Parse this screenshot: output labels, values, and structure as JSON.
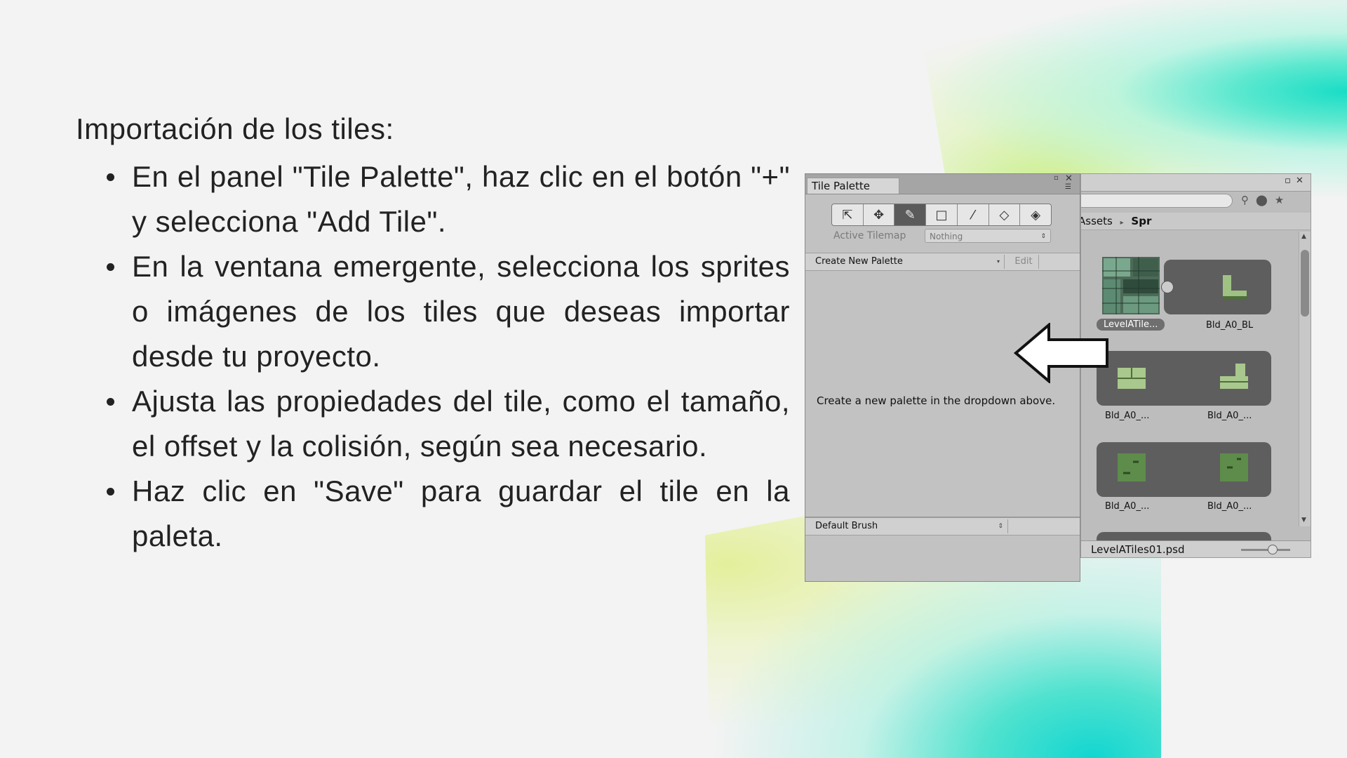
{
  "slide": {
    "title": "Importación de los tiles:",
    "bullets": [
      "En el panel \"Tile Palette\", haz clic en el botón \"+\" y selecciona \"Add Tile\".",
      "En la ventana emergente, selecciona los sprites o imágenes de los tiles que deseas importar desde tu proyecto.",
      "Ajusta las propiedades del tile, como el tamaño, el offset y la colisión, según sea necesario.",
      "Haz clic en \"Save\" para guardar el tile en la paleta."
    ]
  },
  "tile_palette": {
    "tab_title": "Tile Palette",
    "tools": [
      "select-tool",
      "move-tool",
      "paint-brush-tool",
      "box-fill-tool",
      "picker-tool",
      "eraser-tool",
      "flood-fill-tool"
    ],
    "active_tool": "paint-brush-tool",
    "active_tilemap_label": "Active Tilemap",
    "active_tilemap_value": "Nothing",
    "palette_dropdown": "Create New Palette",
    "edit_button": "Edit",
    "empty_message": "Create a new palette in the dropdown above.",
    "brush_dropdown": "Default Brush"
  },
  "project_panel": {
    "breadcrumb_part1": "Assets",
    "breadcrumb_sep": "▸",
    "breadcrumb_part2": "Spr",
    "assets": [
      {
        "label": "LevelATile..."
      },
      {
        "label": "Bld_A0_BL"
      },
      {
        "label": "Bld_A0_..."
      },
      {
        "label": "Bld_A0_..."
      },
      {
        "label": "Bld_A0_..."
      },
      {
        "label": "Bld_A0_..."
      }
    ],
    "footer_file": "LevelATiles01.psd"
  },
  "colors": {
    "background": "#f3f3f3",
    "accent_teal": "#19ddc6",
    "accent_lime": "#c9ef8a",
    "panel_gray": "#c2c2c2"
  }
}
